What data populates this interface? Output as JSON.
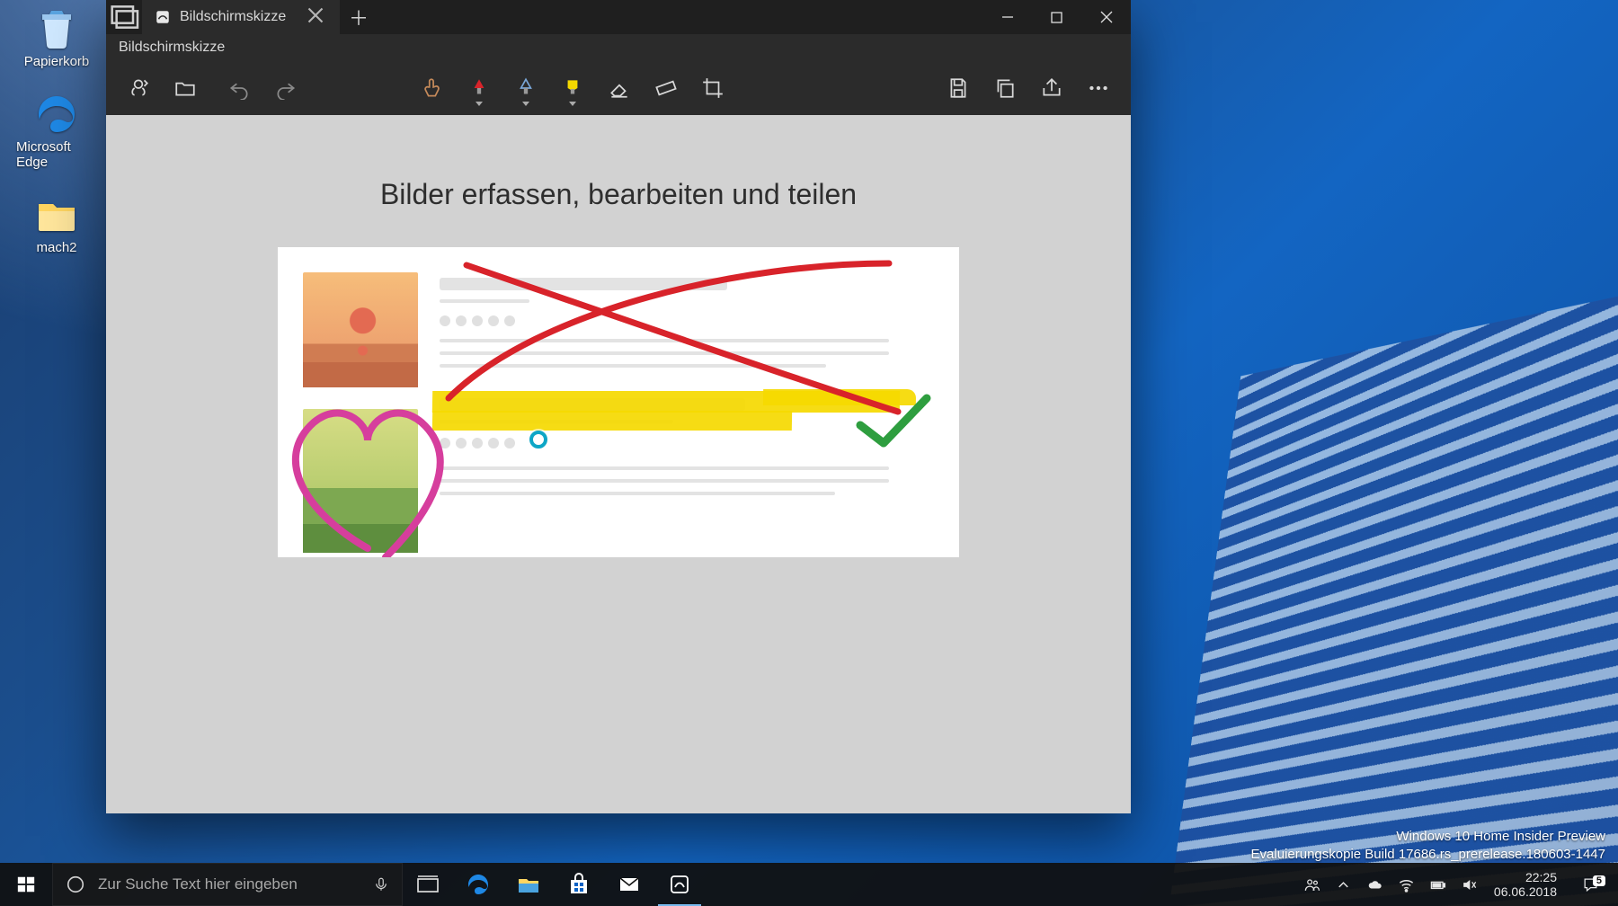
{
  "desktop": {
    "icons": [
      {
        "name": "recycle-bin",
        "label": "Papierkorb"
      },
      {
        "name": "edge",
        "label": "Microsoft Edge"
      },
      {
        "name": "folder-mach2",
        "label": "mach2"
      }
    ],
    "watermark_line1": "Windows 10 Home Insider Preview",
    "watermark_line2": "Evaluierungskopie Build 17686.rs_prerelease.180603-1447"
  },
  "app": {
    "tab_title": "Bildschirmskizze",
    "subtitle": "Bildschirmskizze",
    "canvas_heading": "Bilder erfassen, bearbeiten und teilen",
    "tools": {
      "snip": "Neu ausschneiden",
      "open": "Öffnen",
      "undo": "Rückgängig",
      "redo": "Wiederholen",
      "touch": "Touch-Schreiben",
      "pen_red": "Kugelschreiber",
      "pen_blue": "Bleistift",
      "highlighter": "Textmarker",
      "eraser": "Radierer",
      "ruler": "Lineal",
      "crop": "Zuschneiden",
      "save": "Speichern",
      "copy": "Kopieren",
      "share": "Teilen",
      "more": "Mehr"
    }
  },
  "taskbar": {
    "search_placeholder": "Zur Suche Text hier eingeben",
    "clock_time": "22:25",
    "clock_date": "06.06.2018",
    "notification_count": "5"
  }
}
